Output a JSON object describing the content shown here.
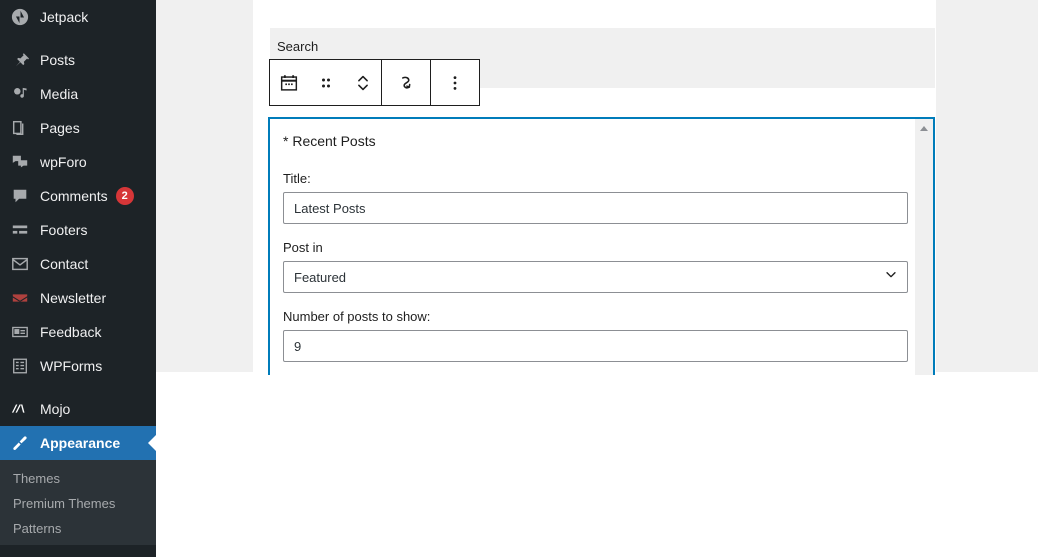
{
  "sidebar": {
    "items": [
      {
        "label": "Jetpack",
        "icon": "jetpack-icon",
        "current": false,
        "badge": null
      },
      {
        "label": "Posts",
        "icon": "pin-icon",
        "current": false,
        "badge": null
      },
      {
        "label": "Media",
        "icon": "media-icon",
        "current": false,
        "badge": null
      },
      {
        "label": "Pages",
        "icon": "pages-icon",
        "current": false,
        "badge": null
      },
      {
        "label": "wpForo",
        "icon": "forum-icon",
        "current": false,
        "badge": null
      },
      {
        "label": "Comments",
        "icon": "comment-icon",
        "current": false,
        "badge": "2"
      },
      {
        "label": "Footers",
        "icon": "footers-icon",
        "current": false,
        "badge": null
      },
      {
        "label": "Contact",
        "icon": "envelope-icon",
        "current": false,
        "badge": null
      },
      {
        "label": "Newsletter",
        "icon": "newsletter-icon",
        "current": false,
        "badge": null
      },
      {
        "label": "Feedback",
        "icon": "feedback-icon",
        "current": false,
        "badge": null
      },
      {
        "label": "WPForms",
        "icon": "wpforms-icon",
        "current": false,
        "badge": null
      },
      {
        "label": "Mojo",
        "icon": "mojo-icon",
        "current": false,
        "badge": null
      },
      {
        "label": "Appearance",
        "icon": "appearance-brush-icon",
        "current": true,
        "badge": null
      }
    ],
    "submenu": [
      {
        "label": "Themes"
      },
      {
        "label": "Premium Themes"
      },
      {
        "label": "Patterns"
      }
    ],
    "colors": {
      "background": "#1d2327",
      "submenu_background": "#2c3338",
      "current_background": "#2271b1",
      "badge_background": "#d63638"
    }
  },
  "canvas": {
    "search_block": {
      "label": "Search"
    },
    "toolbar": {
      "buttons": [
        {
          "name": "block-type-calendar-icon",
          "title": "Search"
        },
        {
          "name": "drag-handle-icon",
          "title": "Drag"
        },
        {
          "name": "move-up-down-icon",
          "title": "Move up or down"
        },
        {
          "name": "transform-icon",
          "title": "Transform"
        },
        {
          "name": "more-options-icon",
          "title": "Options"
        }
      ]
    },
    "widget_panel": {
      "title": "* Recent Posts",
      "accent_color": "#007cba",
      "fields": [
        {
          "name": "title",
          "label": "Title:",
          "type": "text",
          "value": "Latest Posts",
          "placeholder": ""
        },
        {
          "name": "post-in",
          "label": "Post in",
          "type": "select",
          "value": "Featured",
          "options": [
            "Featured"
          ]
        },
        {
          "name": "number-of-posts",
          "label": "Number of posts to show:",
          "type": "number",
          "value": "9",
          "placeholder": ""
        }
      ]
    }
  }
}
